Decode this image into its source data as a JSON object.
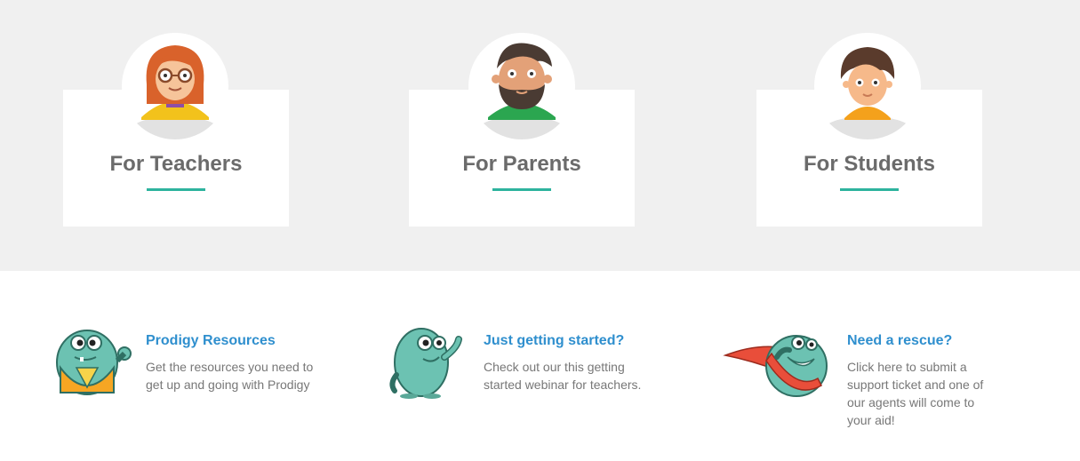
{
  "audience_cards": [
    {
      "title": "For Teachers"
    },
    {
      "title": "For Parents"
    },
    {
      "title": "For Students"
    }
  ],
  "resources": [
    {
      "title": "Prodigy Resources",
      "description": "Get the resources you need to get up and going with Prodigy"
    },
    {
      "title": "Just getting started?",
      "description": "Check out our this getting started webinar for teachers."
    },
    {
      "title": "Need a rescue?",
      "description": "Click here to submit a support ticket and one of our agents will come to your aid!"
    }
  ],
  "colors": {
    "band_background": "#f0f0f0",
    "accent_teal": "#2db39e",
    "link_blue": "#2f8fce",
    "title_gray": "#6b6b6b",
    "body_gray": "#777777"
  },
  "icons": [
    "teacher-avatar-icon",
    "parent-avatar-icon",
    "student-avatar-icon",
    "monster-vest-icon",
    "monster-waving-icon",
    "monster-flying-icon"
  ]
}
